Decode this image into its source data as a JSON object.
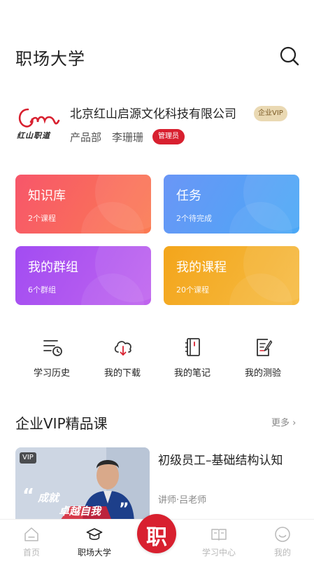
{
  "header": {
    "title": "职场大学"
  },
  "company": {
    "logo_text": "红山职道",
    "name": "北京红山启源文化科技有限公司",
    "vip_badge": "企业VIP",
    "department": "产品部",
    "person": "李珊珊",
    "role_badge": "管理员"
  },
  "cards": [
    {
      "title": "知识库",
      "subtitle": "2个课程",
      "color": "#f7566a"
    },
    {
      "title": "任务",
      "subtitle": "2个待完成",
      "color": "#5b9ff6"
    },
    {
      "title": "我的群组",
      "subtitle": "6个群组",
      "color": "#b058f0"
    },
    {
      "title": "我的课程",
      "subtitle": "20个课程",
      "color": "#f4ae2c"
    }
  ],
  "tools": [
    {
      "label": "学习历史",
      "icon": "history-icon"
    },
    {
      "label": "我的下载",
      "icon": "download-icon"
    },
    {
      "label": "我的笔记",
      "icon": "notebook-icon"
    },
    {
      "label": "我的测验",
      "icon": "quiz-icon"
    }
  ],
  "section": {
    "title": "企业VIP精品课",
    "more": "更多"
  },
  "course": {
    "vip_tag": "VIP",
    "slogan_line1": "成就",
    "slogan_line2": "卓越自我",
    "quote_open": "“",
    "quote_close": "”",
    "title": "初级员工–基础结构认知",
    "teacher": "讲师·吕老师"
  },
  "tabbar": {
    "items": [
      {
        "label": "首页",
        "icon": "home-icon",
        "active": false
      },
      {
        "label": "职场大学",
        "icon": "graduation-cap-icon",
        "active": true
      },
      {
        "label": "学习中心",
        "icon": "book-icon",
        "active": false
      },
      {
        "label": "我的",
        "icon": "profile-icon",
        "active": false
      }
    ],
    "center_label": "职"
  },
  "colors": {
    "brand_red": "#d8202f",
    "vip_gold": "#ead9b3"
  }
}
